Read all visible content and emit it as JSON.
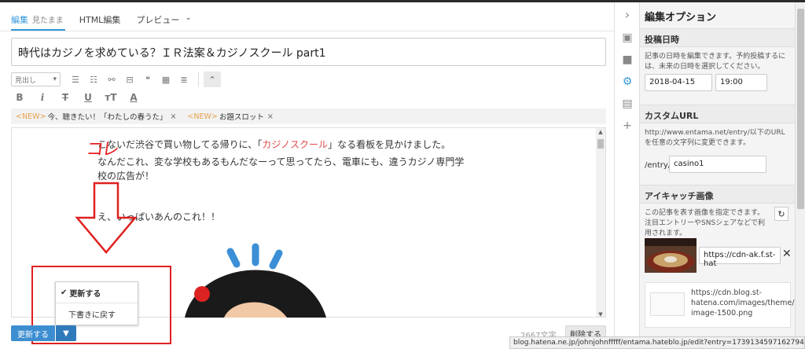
{
  "editor": {
    "tabs": [
      {
        "label": "編集",
        "sub": "見たまま"
      },
      {
        "label": "HTML編集"
      },
      {
        "label": "プレビュー"
      }
    ],
    "title": "時代はカジノを求めている？ＩＲ法案＆カジノスクール part1",
    "style_select": "見出し",
    "tags": [
      {
        "new": "<NEW>",
        "label": "今、聴きたい！「わたしの春うた」"
      },
      {
        "new": "<NEW>",
        "label": "お題スロット"
      }
    ],
    "body": {
      "line1_pre": "こないだ渋谷で買い物してる帰りに、「",
      "line1_red": "カジノスクール",
      "line1_post": "」なる看板を見かけました。",
      "line2": "なんだこれ、変な学校もあるもんだなーって思ってたら、電車にも、違うカジノ専門学",
      "line3": "校の広告が！",
      "line4": "え、いっぱいあんのこれ！！"
    },
    "annotation_text": "コレ",
    "popup": {
      "update": "更新する",
      "revert": "下書きに戻す"
    },
    "footer": {
      "update_label": "更新する",
      "char_count": "2667文字",
      "delete_label": "削除する"
    }
  },
  "panel": {
    "title": "編集オプション",
    "post_date": {
      "heading": "投稿日時",
      "desc": "記事の日時を編集できます。予約投稿するには、未来の日時を選択してください。",
      "date": "2018-04-15",
      "time": "19:00"
    },
    "custom_url": {
      "heading": "カスタムURL",
      "desc": "http://www.entama.net/entry/以下のURLを任意の文字列に変更できます。",
      "prefix": "/entry/",
      "value": "casino1"
    },
    "eyecatch": {
      "heading": "アイキャッチ画像",
      "desc": "この記事を表す画像を指定できます。注目エントリーやSNSシェアなどで利用されます。",
      "url": "https://cdn-ak.f.st-hat",
      "card_url": "https://cdn.blog.st-hatena.com/images/theme/og-image-1500.png"
    }
  },
  "status_url": "blog.hatena.ne.jp/johnjohnfffff/entama.hateblo.jp/edit?entry=17391345971627948101#",
  "colors": {
    "accent": "#3498db",
    "annotation": "#e02020",
    "button": "#3d8ed1"
  }
}
